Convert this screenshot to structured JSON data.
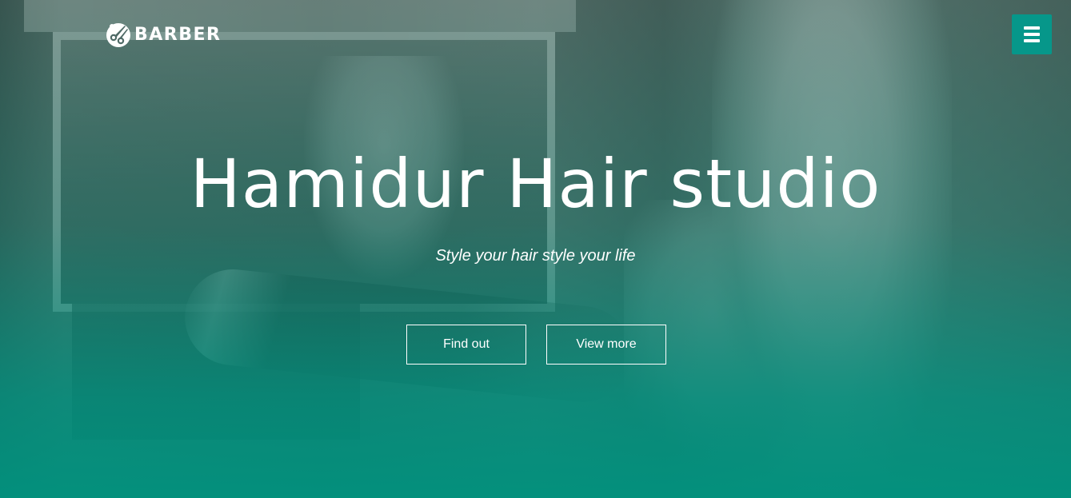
{
  "brand": {
    "logo_text": "BARBER",
    "logo_icon": "scissors-icon"
  },
  "nav": {
    "menu_icon": "hamburger-menu-icon",
    "menu_button_color": "#06978a"
  },
  "hero": {
    "title": "Hamidur Hair studio",
    "subtitle": "Style your hair style your life",
    "primary_button": "Find out",
    "secondary_button": "View more",
    "overlay_color": "#009180"
  }
}
